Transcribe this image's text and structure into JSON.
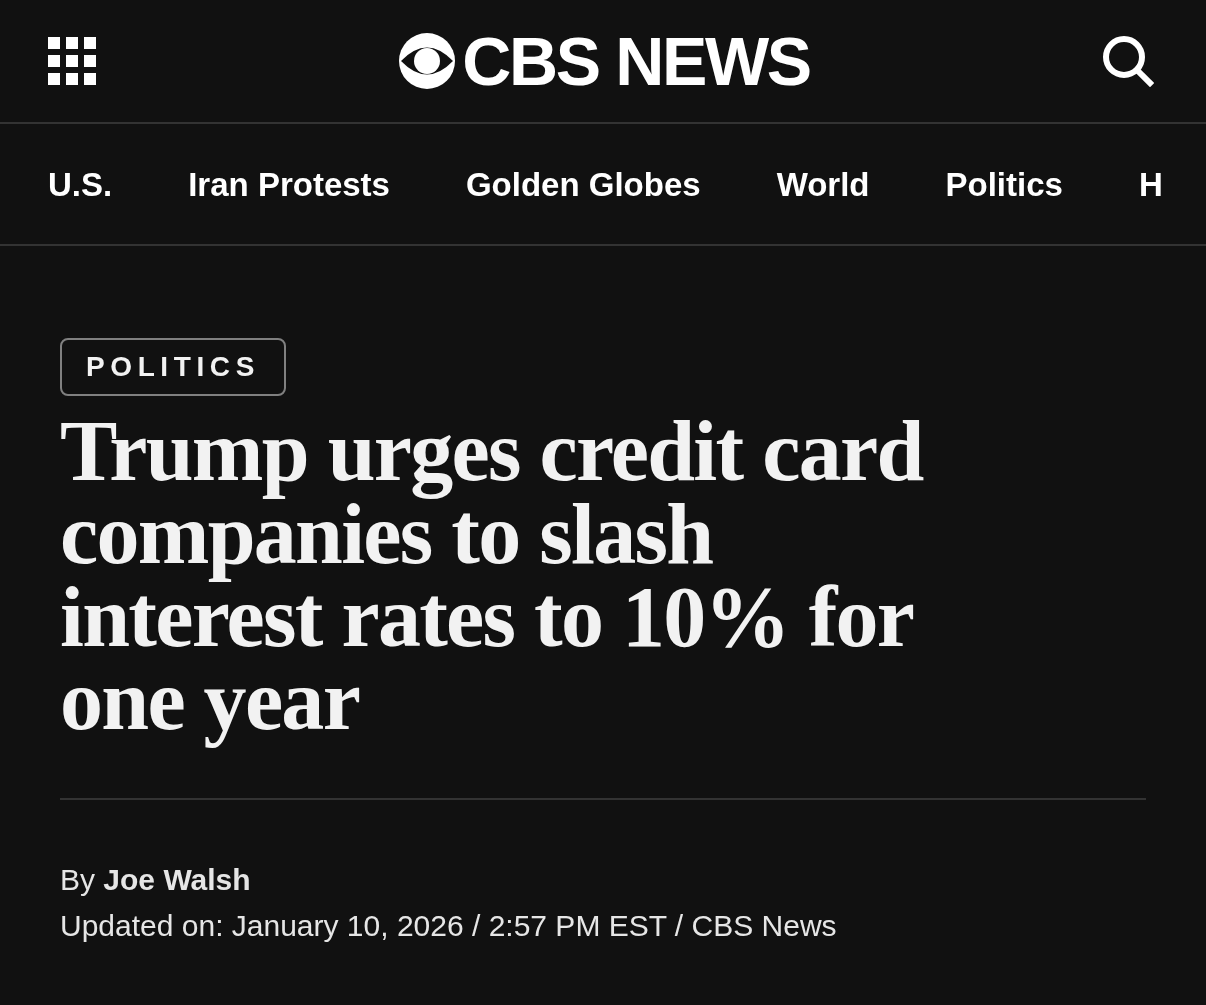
{
  "header": {
    "logo_text": "CBS NEWS"
  },
  "nav": {
    "items": [
      "U.S.",
      "Iran Protests",
      "Golden Globes",
      "World",
      "Politics",
      "H"
    ]
  },
  "article": {
    "category": "POLITICS",
    "headline": "Trump urges credit card companies to slash interest rates to 10% for one year",
    "byline": "By **Joe Walsh**",
    "updated": "Updated on: January 10, 2026 / 2:57 PM EST / CBS News"
  }
}
